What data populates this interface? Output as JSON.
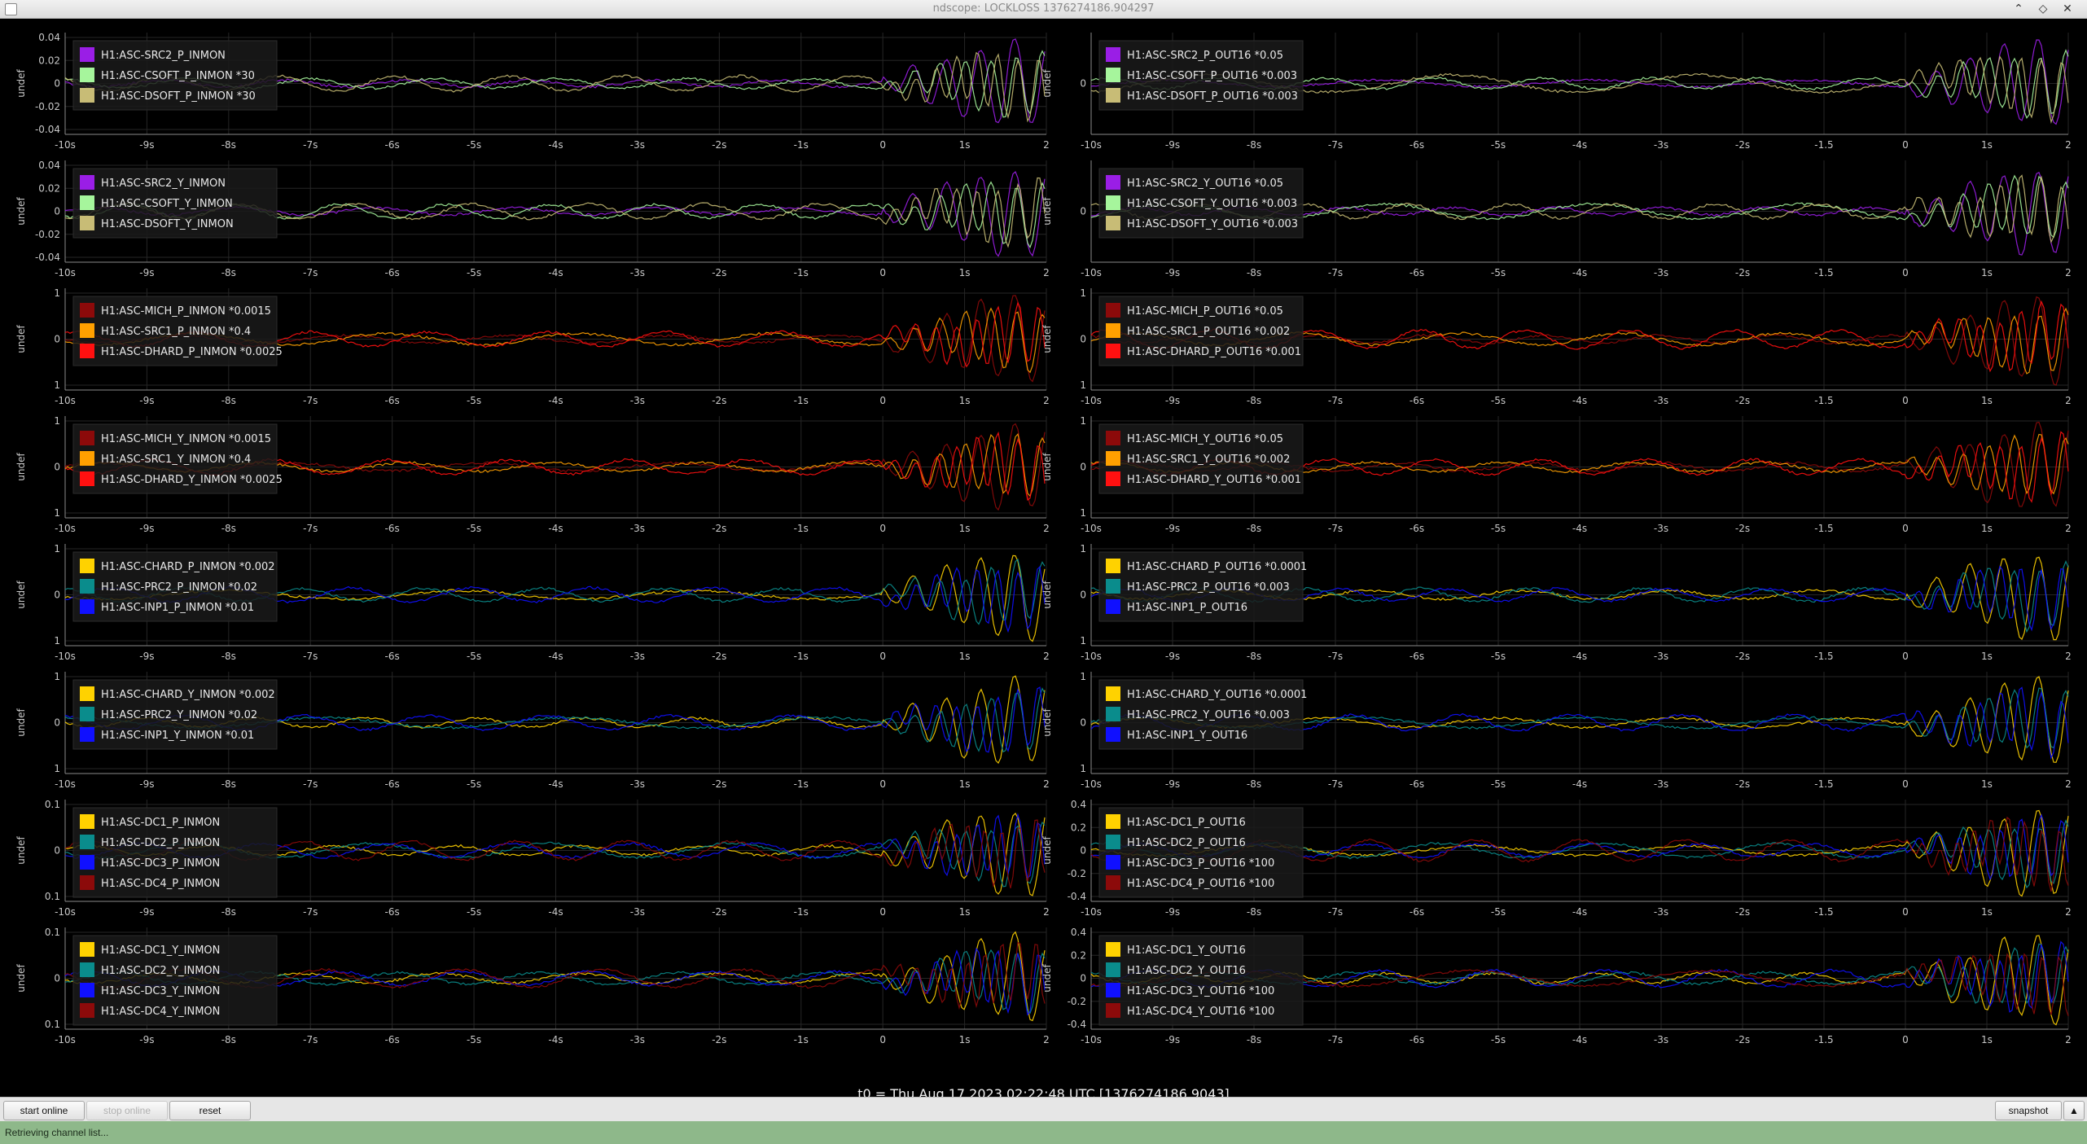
{
  "window": {
    "title": "ndscope: LOCKLOSS 1376274186.904297",
    "min_glyph": "⌃",
    "max_glyph": "◇",
    "close_glyph": "✕"
  },
  "t0_label": "t0 = Thu Aug 17 2023 02:22:48 UTC [1376274186.9043]",
  "toolbar": {
    "start_online": "start online",
    "stop_online": "stop online",
    "reset": "reset",
    "snapshot": "snapshot",
    "expand_glyph": "▲"
  },
  "status": "Retrieving channel list...",
  "colors": {
    "background": "#000000",
    "grid": "#262626",
    "axis_text": "#c8c8c8",
    "purple": "#9a1ee6",
    "light_green": "#a6f59c",
    "khaki": "#c8bc76",
    "dark_red": "#8c0a0a",
    "orange": "#ffa000",
    "red": "#ff1010",
    "yellow": "#ffd200",
    "teal": "#0a8c8c",
    "blue": "#1010ff"
  },
  "x_ticks_left": [
    "-10s",
    "-9s",
    "-8s",
    "-7s",
    "-6s",
    "-5s",
    "-4s",
    "-3s",
    "-2s",
    "-1s",
    "0",
    "1s",
    "2"
  ],
  "x_ticks_right": [
    "-10s",
    "-9s",
    "-8s",
    "-7s",
    "-6s",
    "-5s",
    "-4s",
    "-3s",
    "-2s",
    "-1.5",
    "0",
    "1s",
    "2"
  ],
  "plots": [
    {
      "ylabel": "undef",
      "y_ticks": [
        "0.04",
        "0.02",
        "0",
        "-0.02",
        "-0.04"
      ],
      "legend": [
        {
          "name": "H1:ASC-SRC2_P_INMON",
          "color": "#9a1ee6"
        },
        {
          "name": "H1:ASC-CSOFT_P_INMON *30",
          "color": "#a6f59c"
        },
        {
          "name": "H1:ASC-DSOFT_P_INMON *30",
          "color": "#c8bc76"
        }
      ]
    },
    {
      "ylabel": "undef",
      "y_ticks": [
        "0"
      ],
      "legend": [
        {
          "name": "H1:ASC-SRC2_P_OUT16 *0.05",
          "color": "#9a1ee6"
        },
        {
          "name": "H1:ASC-CSOFT_P_OUT16 *0.003",
          "color": "#a6f59c"
        },
        {
          "name": "H1:ASC-DSOFT_P_OUT16 *0.003",
          "color": "#c8bc76"
        }
      ]
    },
    {
      "ylabel": "undef",
      "y_ticks": [
        "0.04",
        "0.02",
        "0",
        "-0.02",
        "-0.04"
      ],
      "legend": [
        {
          "name": "H1:ASC-SRC2_Y_INMON",
          "color": "#9a1ee6"
        },
        {
          "name": "H1:ASC-CSOFT_Y_INMON",
          "color": "#a6f59c"
        },
        {
          "name": "H1:ASC-DSOFT_Y_INMON",
          "color": "#c8bc76"
        }
      ]
    },
    {
      "ylabel": "undef",
      "y_ticks": [
        "0"
      ],
      "legend": [
        {
          "name": "H1:ASC-SRC2_Y_OUT16 *0.05",
          "color": "#9a1ee6"
        },
        {
          "name": "H1:ASC-CSOFT_Y_OUT16 *0.003",
          "color": "#a6f59c"
        },
        {
          "name": "H1:ASC-DSOFT_Y_OUT16 *0.003",
          "color": "#c8bc76"
        }
      ]
    },
    {
      "ylabel": "undef",
      "y_ticks": [
        "1",
        "0",
        "1"
      ],
      "legend": [
        {
          "name": "H1:ASC-MICH_P_INMON *0.0015",
          "color": "#8c0a0a"
        },
        {
          "name": "H1:ASC-SRC1_P_INMON *0.4",
          "color": "#ffa000"
        },
        {
          "name": "H1:ASC-DHARD_P_INMON *0.0025",
          "color": "#ff1010"
        }
      ]
    },
    {
      "ylabel": "undef",
      "y_ticks": [
        "1",
        "0",
        "1"
      ],
      "legend": [
        {
          "name": "H1:ASC-MICH_P_OUT16 *0.05",
          "color": "#8c0a0a"
        },
        {
          "name": "H1:ASC-SRC1_P_OUT16 *0.002",
          "color": "#ffa000"
        },
        {
          "name": "H1:ASC-DHARD_P_OUT16 *0.001",
          "color": "#ff1010"
        }
      ]
    },
    {
      "ylabel": "undef",
      "y_ticks": [
        "1",
        "0",
        "1"
      ],
      "legend": [
        {
          "name": "H1:ASC-MICH_Y_INMON *0.0015",
          "color": "#8c0a0a"
        },
        {
          "name": "H1:ASC-SRC1_Y_INMON *0.4",
          "color": "#ffa000"
        },
        {
          "name": "H1:ASC-DHARD_Y_INMON *0.0025",
          "color": "#ff1010"
        }
      ]
    },
    {
      "ylabel": "undef",
      "y_ticks": [
        "1",
        "0",
        "1"
      ],
      "legend": [
        {
          "name": "H1:ASC-MICH_Y_OUT16 *0.05",
          "color": "#8c0a0a"
        },
        {
          "name": "H1:ASC-SRC1_Y_OUT16 *0.002",
          "color": "#ffa000"
        },
        {
          "name": "H1:ASC-DHARD_Y_OUT16 *0.001",
          "color": "#ff1010"
        }
      ]
    },
    {
      "ylabel": "undef",
      "y_ticks": [
        "1",
        "0",
        "1"
      ],
      "legend": [
        {
          "name": "H1:ASC-CHARD_P_INMON *0.002",
          "color": "#ffd200"
        },
        {
          "name": "H1:ASC-PRC2_P_INMON *0.02",
          "color": "#0a8c8c"
        },
        {
          "name": "H1:ASC-INP1_P_INMON *0.01",
          "color": "#1010ff"
        }
      ]
    },
    {
      "ylabel": "undef",
      "y_ticks": [
        "1",
        "0",
        "1"
      ],
      "legend": [
        {
          "name": "H1:ASC-CHARD_P_OUT16 *0.0001",
          "color": "#ffd200"
        },
        {
          "name": "H1:ASC-PRC2_P_OUT16 *0.003",
          "color": "#0a8c8c"
        },
        {
          "name": "H1:ASC-INP1_P_OUT16",
          "color": "#1010ff"
        }
      ]
    },
    {
      "ylabel": "undef",
      "y_ticks": [
        "1",
        "0",
        "1"
      ],
      "legend": [
        {
          "name": "H1:ASC-CHARD_Y_INMON *0.002",
          "color": "#ffd200"
        },
        {
          "name": "H1:ASC-PRC2_Y_INMON *0.02",
          "color": "#0a8c8c"
        },
        {
          "name": "H1:ASC-INP1_Y_INMON *0.01",
          "color": "#1010ff"
        }
      ]
    },
    {
      "ylabel": "undef",
      "y_ticks": [
        "1",
        "0",
        "1"
      ],
      "legend": [
        {
          "name": "H1:ASC-CHARD_Y_OUT16 *0.0001",
          "color": "#ffd200"
        },
        {
          "name": "H1:ASC-PRC2_Y_OUT16 *0.003",
          "color": "#0a8c8c"
        },
        {
          "name": "H1:ASC-INP1_Y_OUT16",
          "color": "#1010ff"
        }
      ]
    },
    {
      "ylabel": "undef",
      "y_ticks": [
        "0.1",
        "0",
        "0.1"
      ],
      "legend": [
        {
          "name": "H1:ASC-DC1_P_INMON",
          "color": "#ffd200"
        },
        {
          "name": "H1:ASC-DC2_P_INMON",
          "color": "#0a8c8c"
        },
        {
          "name": "H1:ASC-DC3_P_INMON",
          "color": "#1010ff"
        },
        {
          "name": "H1:ASC-DC4_P_INMON",
          "color": "#8c0a0a"
        }
      ]
    },
    {
      "ylabel": "undef",
      "y_ticks": [
        "0.4",
        "0.2",
        "0",
        "-0.2",
        "-0.4"
      ],
      "legend": [
        {
          "name": "H1:ASC-DC1_P_OUT16",
          "color": "#ffd200"
        },
        {
          "name": "H1:ASC-DC2_P_OUT16",
          "color": "#0a8c8c"
        },
        {
          "name": "H1:ASC-DC3_P_OUT16 *100",
          "color": "#1010ff"
        },
        {
          "name": "H1:ASC-DC4_P_OUT16 *100",
          "color": "#8c0a0a"
        }
      ]
    },
    {
      "ylabel": "undef",
      "y_ticks": [
        "0.1",
        "0",
        "0.1"
      ],
      "legend": [
        {
          "name": "H1:ASC-DC1_Y_INMON",
          "color": "#ffd200"
        },
        {
          "name": "H1:ASC-DC2_Y_INMON",
          "color": "#0a8c8c"
        },
        {
          "name": "H1:ASC-DC3_Y_INMON",
          "color": "#1010ff"
        },
        {
          "name": "H1:ASC-DC4_Y_INMON",
          "color": "#8c0a0a"
        }
      ]
    },
    {
      "ylabel": "undef",
      "y_ticks": [
        "0.4",
        "0.2",
        "0",
        "-0.2",
        "-0.4"
      ],
      "legend": [
        {
          "name": "H1:ASC-DC1_Y_OUT16",
          "color": "#ffd200"
        },
        {
          "name": "H1:ASC-DC2_Y_OUT16",
          "color": "#0a8c8c"
        },
        {
          "name": "H1:ASC-DC3_Y_OUT16 *100",
          "color": "#1010ff"
        },
        {
          "name": "H1:ASC-DC4_Y_OUT16 *100",
          "color": "#8c0a0a"
        }
      ]
    }
  ]
}
